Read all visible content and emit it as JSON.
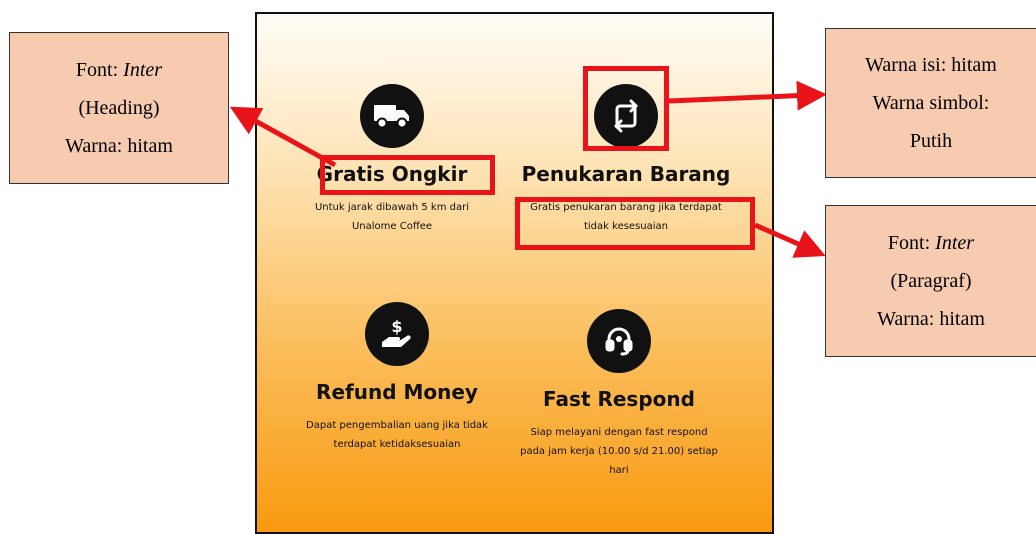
{
  "features": [
    {
      "icon": "truck-icon",
      "title": "Gratis Ongkir",
      "lines": [
        "Untuk jarak dibawah 5 km dari",
        "Unalome Coffee"
      ]
    },
    {
      "icon": "swap-icon",
      "title": "Penukaran Barang",
      "lines": [
        "Gratis penukaran barang jika terdapat",
        "tidak kesesuaian"
      ]
    },
    {
      "icon": "money-hand-icon",
      "title": "Refund Money",
      "lines": [
        "Dapat pengembalian uang jika tidak",
        "terdapat ketidaksesuaian"
      ]
    },
    {
      "icon": "headset-icon",
      "title": "Fast Respond",
      "lines": [
        "Siap melayani dengan fast respond",
        "pada jam kerja (10.00 s/d 21.00) setiap",
        "hari"
      ]
    }
  ],
  "notes": {
    "heading": {
      "font_label": "Font: ",
      "font_name": "Inter",
      "kind": "(Heading)",
      "color": "Warna: hitam"
    },
    "icon": {
      "fill": "Warna isi: hitam",
      "symbol_label": "Warna simbol:",
      "symbol_value": "Putih"
    },
    "paragraph": {
      "font_label": "Font: ",
      "font_name": "Inter",
      "kind": "(Paragraf)",
      "color": "Warna: hitam"
    }
  },
  "colors": {
    "highlight": "#e8141a",
    "note_fill": "#f7cbb0",
    "gradient_top": "#fffdf8",
    "gradient_bottom": "#f99a10"
  }
}
